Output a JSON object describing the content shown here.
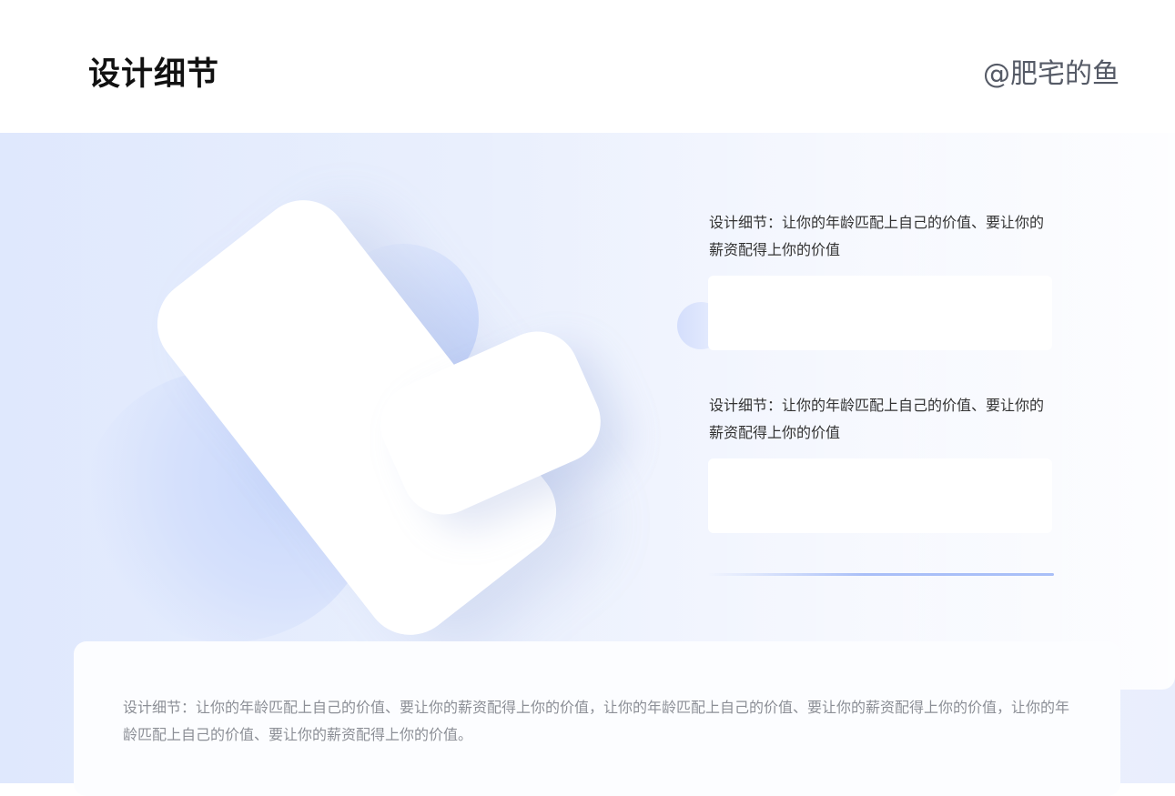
{
  "header": {
    "title": "设计细节",
    "author": "@肥宅的鱼"
  },
  "features": [
    {
      "text": "设计细节：让你的年龄匹配上自己的价值、要让你的薪资配得上你的价值"
    },
    {
      "text": "设计细节：让你的年龄匹配上自己的价值、要让你的薪资配得上你的价值"
    }
  ],
  "footer": {
    "text": "设计细节：让你的年龄匹配上自己的价值、要让你的薪资配得上你的价值，让你的年龄匹配上自己的价值、要让你的薪资配得上你的价值，让你的年龄匹配上自己的价值、要让你的薪资配得上你的价值。"
  },
  "colors": {
    "accent": "#a9bff8",
    "background": "#e6edfd",
    "title": "#111111"
  }
}
